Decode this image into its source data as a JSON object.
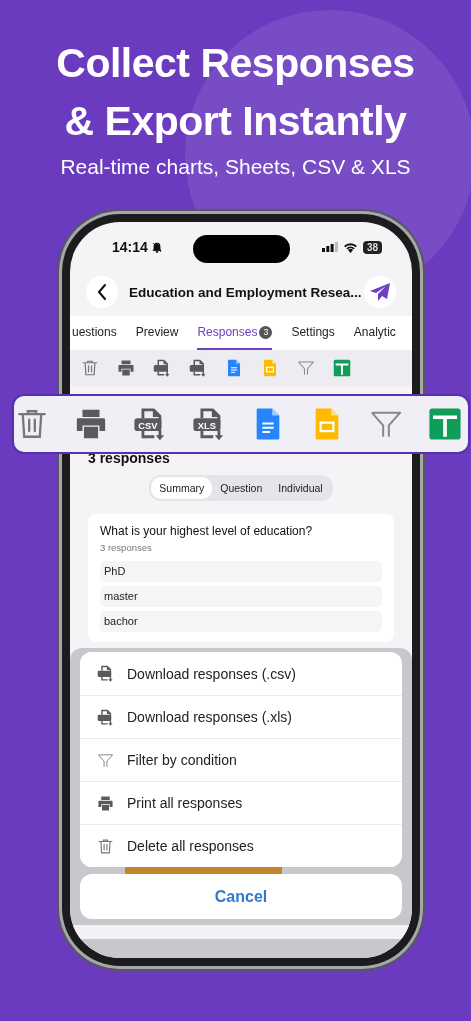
{
  "headline": [
    "Collect Responses",
    "& Export Instantly"
  ],
  "subtitle": "Real-time charts, Sheets, CSV & XLS",
  "status_bar": {
    "time": "14:14",
    "battery": "38"
  },
  "header": {
    "title": "Education and Employment Resea..."
  },
  "tabs": [
    {
      "label": "uestions",
      "selected": false
    },
    {
      "label": "Preview",
      "selected": false
    },
    {
      "label": "Responses",
      "badge": "3",
      "selected": true
    },
    {
      "label": "Settings",
      "selected": false
    },
    {
      "label": "Analytic",
      "selected": false
    }
  ],
  "toolbar": [
    {
      "kind": "delete"
    },
    {
      "kind": "print"
    },
    {
      "kind": "csv"
    },
    {
      "kind": "xls"
    },
    {
      "kind": "docs"
    },
    {
      "kind": "slides"
    },
    {
      "kind": "filter"
    },
    {
      "kind": "sheets"
    }
  ],
  "zoomed_toolbar": [
    {
      "kind": "delete"
    },
    {
      "kind": "print"
    },
    {
      "kind": "csv",
      "badge": "CSV"
    },
    {
      "kind": "xls",
      "badge": "XLS"
    },
    {
      "kind": "docs"
    },
    {
      "kind": "slides"
    },
    {
      "kind": "filter"
    },
    {
      "kind": "sheets"
    }
  ],
  "response_count": "3 responses",
  "view_switch": [
    {
      "label": "Summary",
      "selected": true
    },
    {
      "label": "Question",
      "selected": false
    },
    {
      "label": "Individual",
      "selected": false
    }
  ],
  "question_card": {
    "question": "What is your highest level of education?",
    "count": "3 responses",
    "answers": [
      "PhD",
      "master",
      "bachor"
    ]
  },
  "action_sheet": {
    "items": [
      {
        "kind": "csv",
        "label": "Download responses (.csv)"
      },
      {
        "kind": "xls",
        "label": "Download responses (.xls)"
      },
      {
        "kind": "filter",
        "label": "Filter by condition"
      },
      {
        "kind": "print",
        "label": "Print all responses"
      },
      {
        "kind": "delete",
        "label": "Delete all responses"
      }
    ],
    "cancel": "Cancel"
  }
}
